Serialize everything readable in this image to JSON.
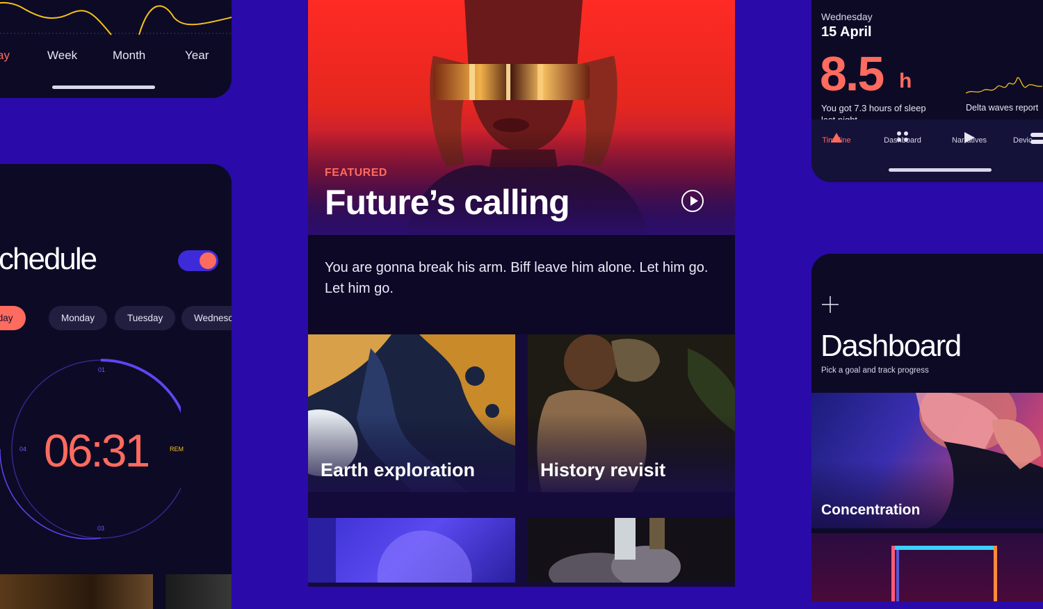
{
  "period_panel": {
    "tabs": [
      "ay",
      "Week",
      "Month",
      "Year"
    ],
    "active_tab": "ay"
  },
  "schedule_panel": {
    "title": "chedule",
    "toggle_on": true,
    "days": [
      "eryday",
      "Monday",
      "Tuesday",
      "Wednesc"
    ],
    "active_day": "eryday",
    "time": "06:31",
    "dial_labels": {
      "top": "01",
      "left": "04",
      "bottom": "03",
      "right": "REM"
    }
  },
  "feature_panel": {
    "eyebrow": "FEATURED",
    "title": "Future’s calling",
    "quote": "You are gonna break his arm. Biff leave him alone. Let him go. Let him go.",
    "tiles": [
      {
        "label": "Earth exploration"
      },
      {
        "label": "History revisit"
      }
    ]
  },
  "sleep_panel": {
    "day_of_week": "Wednesday",
    "date": "15 April",
    "hours": "8.5",
    "unit": "h",
    "note": "You got 7.3 hours of sleep",
    "note_cont": "last night",
    "delta_label": "Delta waves report",
    "nav": [
      {
        "label": "Timeline",
        "icon": "triangle-icon",
        "active": true
      },
      {
        "label": "Dashboard",
        "icon": "dots-grid-icon",
        "active": false
      },
      {
        "label": "Narratives",
        "icon": "play-icon",
        "active": false
      },
      {
        "label": "Devic",
        "icon": "device-icon",
        "active": false
      }
    ]
  },
  "dashboard_panel": {
    "title": "Dashboard",
    "subtitle": "Pick a goal and track progress",
    "tiles": [
      {
        "label": "Concentration"
      }
    ]
  },
  "colors": {
    "background": "#2a0aa8",
    "accent": "#ff6b5e",
    "panel": "#0d0a26",
    "dial_violet": "#5b47f0",
    "dial_yellow": "#f5c218"
  }
}
